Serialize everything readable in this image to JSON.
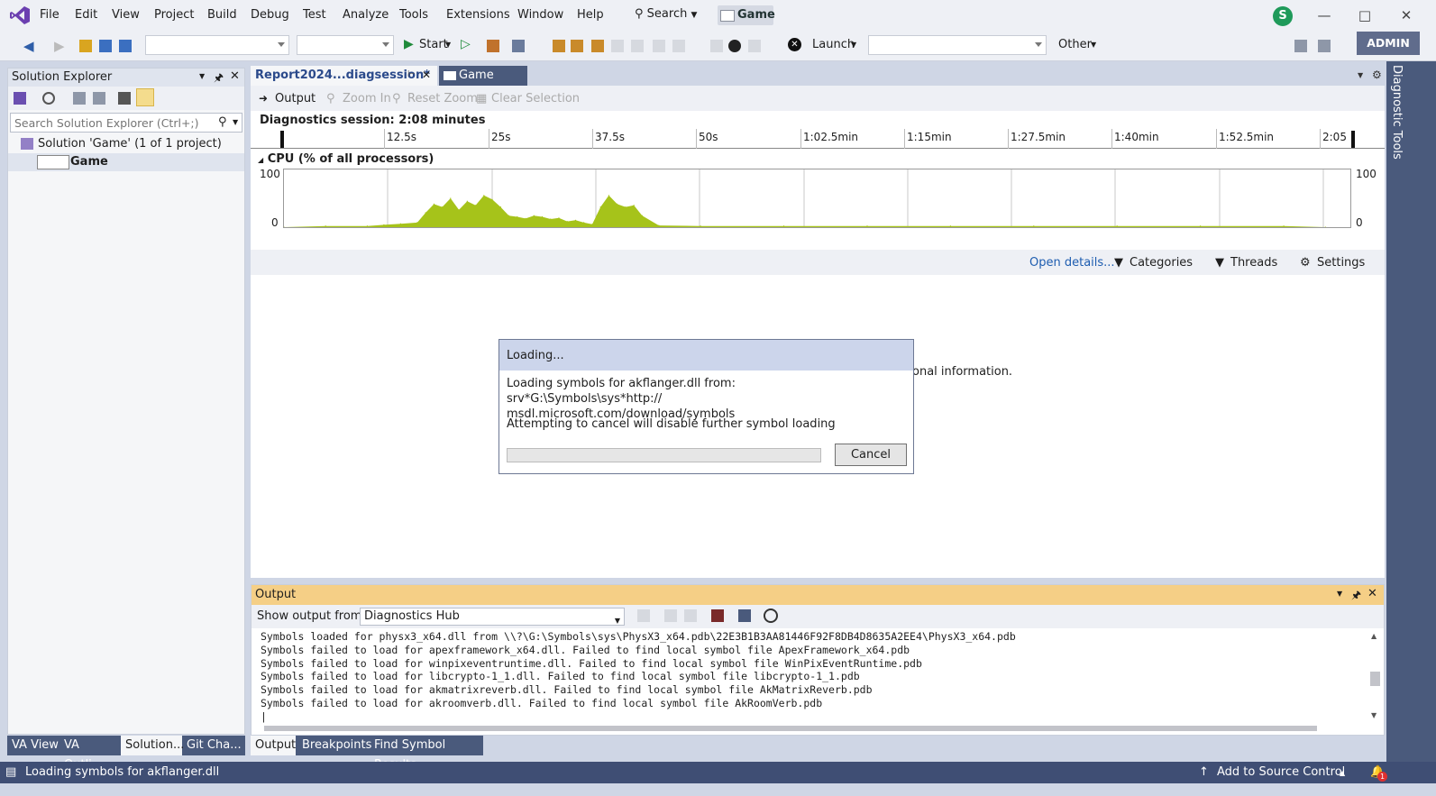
{
  "menu": {
    "items": [
      "File",
      "Edit",
      "View",
      "Project",
      "Build",
      "Debug",
      "Test",
      "Analyze",
      "Tools",
      "Extensions",
      "Window",
      "Help"
    ],
    "search_label": "Search",
    "solution_badge": "Game",
    "avatar_letter": "S"
  },
  "toolbar": {
    "start_label": "Start",
    "launch_label": "Launch",
    "other_label": "Other",
    "admin_label": "ADMIN"
  },
  "solution_explorer": {
    "title": "Solution Explorer",
    "search_placeholder": "Search Solution Explorer (Ctrl+;)",
    "solution_row": "Solution 'Game' (1 of 1 project)",
    "project_row": "Game"
  },
  "left_tabs": [
    "VA View",
    "VA Outli...",
    "Solution...",
    "Git Cha..."
  ],
  "doc_tabs": {
    "report": "Report2024...diagsession*",
    "game": "Game"
  },
  "doc_toolbar": {
    "output": "Output",
    "zoom_in": "Zoom In",
    "reset_zoom": "Reset Zoom",
    "clear_selection": "Clear Selection"
  },
  "session": "Diagnostics session: 2:08 minutes",
  "ruler_ticks": [
    "12.5s",
    "25s",
    "37.5s",
    "50s",
    "1:02.5min",
    "1:15min",
    "1:27.5min",
    "1:40min",
    "1:52.5min",
    "2:05"
  ],
  "chart_data": {
    "type": "area",
    "title": "CPU (% of all processors)",
    "ylim": [
      0,
      100
    ],
    "y_ticks_left": [
      "100",
      "0"
    ],
    "y_ticks_right": [
      "100",
      "0"
    ],
    "series": [
      {
        "name": "CPU",
        "color": "#a6c31a",
        "x_seconds": [
          0,
          5,
          10,
          12,
          14,
          16,
          17,
          18,
          19,
          20,
          21,
          22,
          23,
          24,
          25,
          26,
          27,
          28,
          29,
          30,
          31,
          32,
          33,
          34,
          35,
          36,
          37,
          38,
          39,
          40,
          41,
          42,
          43,
          45,
          50,
          60,
          70,
          80,
          90,
          100,
          110,
          120,
          125
        ],
        "values": [
          0,
          2,
          2,
          4,
          6,
          8,
          25,
          40,
          35,
          50,
          30,
          45,
          38,
          55,
          48,
          35,
          20,
          18,
          15,
          20,
          18,
          14,
          16,
          10,
          12,
          8,
          5,
          35,
          55,
          40,
          35,
          38,
          20,
          3,
          2,
          2,
          2,
          2,
          2,
          2,
          2,
          2,
          0
        ]
      }
    ]
  },
  "details_bar": {
    "open_details": "Open details...",
    "categories": "Categories",
    "threads": "Threads",
    "settings": "Settings"
  },
  "bg_info_fragment": "onal information.",
  "dialog": {
    "title": "Loading...",
    "message_line1": "Loading symbols for akflanger.dll from: srv*G:\\Symbols\\sys*http://",
    "message_line2": "msdl.microsoft.com/download/symbols",
    "warning": "Attempting to cancel will disable further symbol loading",
    "progress": 0,
    "cancel_label": "Cancel"
  },
  "output": {
    "title": "Output",
    "show_from_label": "Show output from:",
    "source": "Diagnostics Hub",
    "lines": [
      "Symbols loaded for physx3_x64.dll from \\\\?\\G:\\Symbols\\sys\\PhysX3_x64.pdb\\22E3B1B3AA81446F92F8DB4D8635A2EE4\\PhysX3_x64.pdb",
      "Symbols failed to load for apexframework_x64.dll. Failed to find local symbol file ApexFramework_x64.pdb",
      "Symbols failed to load for winpixeventruntime.dll. Failed to find local symbol file WinPixEventRuntime.pdb",
      "Symbols failed to load for libcrypto-1_1.dll. Failed to find local symbol file libcrypto-1_1.pdb",
      "Symbols failed to load for akmatrixreverb.dll. Failed to find local symbol file AkMatrixReverb.pdb",
      "Symbols failed to load for akroomverb.dll. Failed to find local symbol file AkRoomVerb.pdb"
    ]
  },
  "output_tabs": [
    "Output",
    "Breakpoints",
    "Find Symbol Results"
  ],
  "diagnostic_tools_label": "Diagnostic Tools",
  "status": {
    "message": "Loading symbols for akflanger.dll",
    "source_control": "Add to Source Control",
    "notification_count": "1"
  }
}
